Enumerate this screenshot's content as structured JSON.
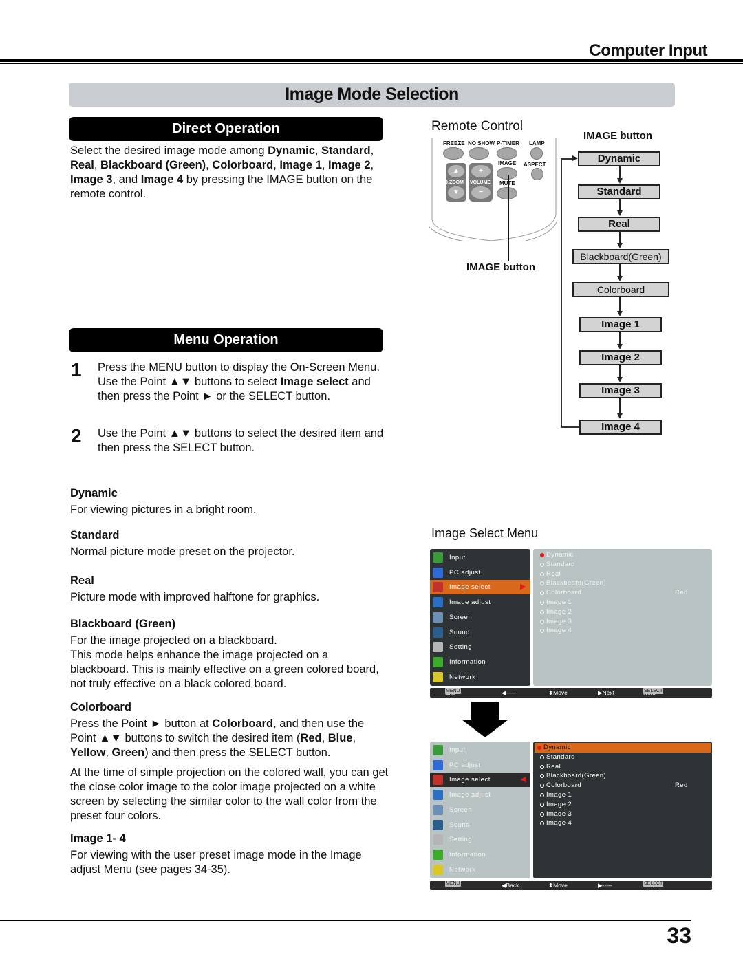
{
  "header": {
    "section": "Computer Input"
  },
  "title": "Image Mode Selection",
  "direct_operation": {
    "heading": "Direct Operation",
    "text": [
      {
        "t": "Select the desired image mode among "
      },
      {
        "b": "Dynamic"
      },
      {
        "t": ", "
      },
      {
        "b": "Standard"
      },
      {
        "t": ", "
      },
      {
        "b": "Real"
      },
      {
        "t": ", "
      },
      {
        "b": "Blackboard (Green)"
      },
      {
        "t": ", "
      },
      {
        "b": "Colorboard"
      },
      {
        "t": ", "
      },
      {
        "b": "Image 1"
      },
      {
        "t": ", "
      },
      {
        "b": "Image 2"
      },
      {
        "t": ", "
      },
      {
        "b": "Image 3"
      },
      {
        "t": ", and "
      },
      {
        "b": "Image 4"
      },
      {
        "t": " by pressing the IMAGE button on the remote control."
      }
    ]
  },
  "menu_operation": {
    "heading": "Menu Operation",
    "steps": [
      {
        "num": "1",
        "text": [
          {
            "t": "Press the MENU button to display the On-Screen Menu. Use the Point ▲▼ buttons to select "
          },
          {
            "b": "Image select"
          },
          {
            "t": " and then press the Point ► or the SELECT button."
          }
        ]
      },
      {
        "num": "2",
        "text": [
          {
            "t": "Use the Point ▲▼ buttons to select the desired item and then press the SELECT button."
          }
        ]
      }
    ]
  },
  "modes": [
    {
      "name": "Dynamic",
      "desc": [
        [
          {
            "t": "For viewing pictures in a bright room."
          }
        ]
      ]
    },
    {
      "name": "Standard",
      "desc": [
        [
          {
            "t": "Normal picture mode preset on the projector."
          }
        ]
      ]
    },
    {
      "name": "Real",
      "desc": [
        [
          {
            "t": "Picture mode with improved halftone for graphics."
          }
        ]
      ]
    },
    {
      "name": "Blackboard (Green)",
      "desc": [
        [
          {
            "t": "For the image projected on a blackboard."
          }
        ],
        [
          {
            "t": "This mode helps enhance the image projected on a blackboard. This is mainly effective on a green colored board, not truly effective on a black colored board."
          }
        ]
      ]
    },
    {
      "name": "Colorboard",
      "desc": [
        [
          {
            "t": "Press the Point ► button at "
          },
          {
            "b": "Colorboard"
          },
          {
            "t": ", and then use the Point ▲▼ buttons to switch the desired item ("
          },
          {
            "b": "Red"
          },
          {
            "t": ", "
          },
          {
            "b": "Blue"
          },
          {
            "t": ", "
          },
          {
            "b": "Yellow"
          },
          {
            "t": ", "
          },
          {
            "b": "Green"
          },
          {
            "t": ") and then press the SELECT button."
          }
        ],
        [
          {
            "t": "At the time of simple projection on the colored wall, you can get the close color image to the color image projected on a white screen by selecting the similar color to the wall color from the preset four colors."
          }
        ]
      ]
    },
    {
      "name": "Image 1- 4",
      "desc": [
        [
          {
            "t": "For viewing with the user preset image mode in the Image adjust Menu (see pages 34-35)."
          }
        ]
      ]
    }
  ],
  "remote_control": {
    "title": "Remote Control",
    "buttons_row1": [
      "FREEZE",
      "NO SHOW",
      "P-TIMER",
      "LAMP"
    ],
    "label_image": "IMAGE",
    "label_aspect": "ASPECT",
    "label_mute": "MUTE",
    "label_dzoom": "D.ZOOM",
    "label_volume": "VOLUME",
    "image_button_label": "IMAGE button"
  },
  "flow": {
    "label": "IMAGE button",
    "items": [
      "Dynamic",
      "Standard",
      "Real",
      "Blackboard(Green)",
      "Colorboard",
      "Image 1",
      "Image 2",
      "Image 3",
      "Image 4"
    ]
  },
  "image_select_menu": {
    "title": "Image Select Menu",
    "main_items": [
      "Input",
      "PC adjust",
      "Image select",
      "Image adjust",
      "Screen",
      "Sound",
      "Setting",
      "Information",
      "Network"
    ],
    "sub_items": [
      "Dynamic",
      "Standard",
      "Real",
      "Blackboard(Green)",
      "Colorboard",
      "Image 1",
      "Image 2",
      "Image 3",
      "Image 4"
    ],
    "colorboard_value": "Red",
    "footer1": {
      "menu_key": "MENU",
      "exit": "Exit",
      "back": "-----",
      "move": "Move",
      "next": "Next",
      "select_key": "SELECT",
      "select_action": "Next"
    },
    "footer2": {
      "menu_key": "MENU",
      "exit": "Exit",
      "back": "Back",
      "move": "Move",
      "next": "-----",
      "select_key": "SELECT",
      "select_action": "Select"
    }
  },
  "colors": {
    "accent_orange": "#d8681c",
    "selected_dot": "#e31b1b",
    "osd_dark": "#2e3336",
    "osd_light": "#b9c3c4"
  },
  "page_number": "33"
}
